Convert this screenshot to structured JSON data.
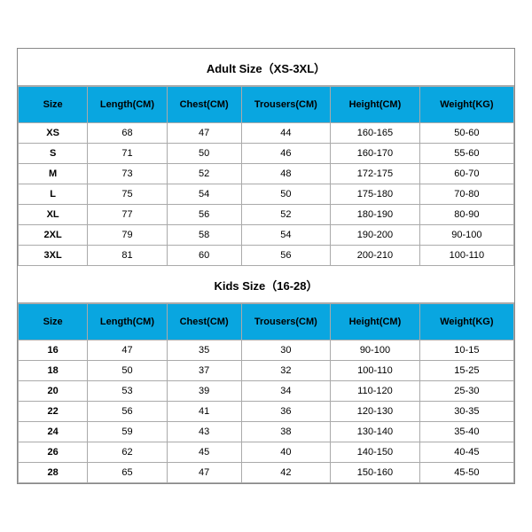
{
  "columns": [
    "Size",
    "Length(CM)",
    "Chest(CM)",
    "Trousers(CM)",
    "Height(CM)",
    "Weight(KG)"
  ],
  "adult": {
    "title": "Adult Size（XS-3XL）",
    "rows": [
      {
        "size": "XS",
        "length": "68",
        "chest": "47",
        "trousers": "44",
        "height": "160-165",
        "weight": "50-60"
      },
      {
        "size": "S",
        "length": "71",
        "chest": "50",
        "trousers": "46",
        "height": "160-170",
        "weight": "55-60"
      },
      {
        "size": "M",
        "length": "73",
        "chest": "52",
        "trousers": "48",
        "height": "172-175",
        "weight": "60-70"
      },
      {
        "size": "L",
        "length": "75",
        "chest": "54",
        "trousers": "50",
        "height": "175-180",
        "weight": "70-80"
      },
      {
        "size": "XL",
        "length": "77",
        "chest": "56",
        "trousers": "52",
        "height": "180-190",
        "weight": "80-90"
      },
      {
        "size": "2XL",
        "length": "79",
        "chest": "58",
        "trousers": "54",
        "height": "190-200",
        "weight": "90-100"
      },
      {
        "size": "3XL",
        "length": "81",
        "chest": "60",
        "trousers": "56",
        "height": "200-210",
        "weight": "100-110"
      }
    ]
  },
  "kids": {
    "title": "Kids Size（16-28）",
    "rows": [
      {
        "size": "16",
        "length": "47",
        "chest": "35",
        "trousers": "30",
        "height": "90-100",
        "weight": "10-15"
      },
      {
        "size": "18",
        "length": "50",
        "chest": "37",
        "trousers": "32",
        "height": "100-110",
        "weight": "15-25"
      },
      {
        "size": "20",
        "length": "53",
        "chest": "39",
        "trousers": "34",
        "height": "110-120",
        "weight": "25-30"
      },
      {
        "size": "22",
        "length": "56",
        "chest": "41",
        "trousers": "36",
        "height": "120-130",
        "weight": "30-35"
      },
      {
        "size": "24",
        "length": "59",
        "chest": "43",
        "trousers": "38",
        "height": "130-140",
        "weight": "35-40"
      },
      {
        "size": "26",
        "length": "62",
        "chest": "45",
        "trousers": "40",
        "height": "140-150",
        "weight": "40-45"
      },
      {
        "size": "28",
        "length": "65",
        "chest": "47",
        "trousers": "42",
        "height": "150-160",
        "weight": "45-50"
      }
    ]
  }
}
